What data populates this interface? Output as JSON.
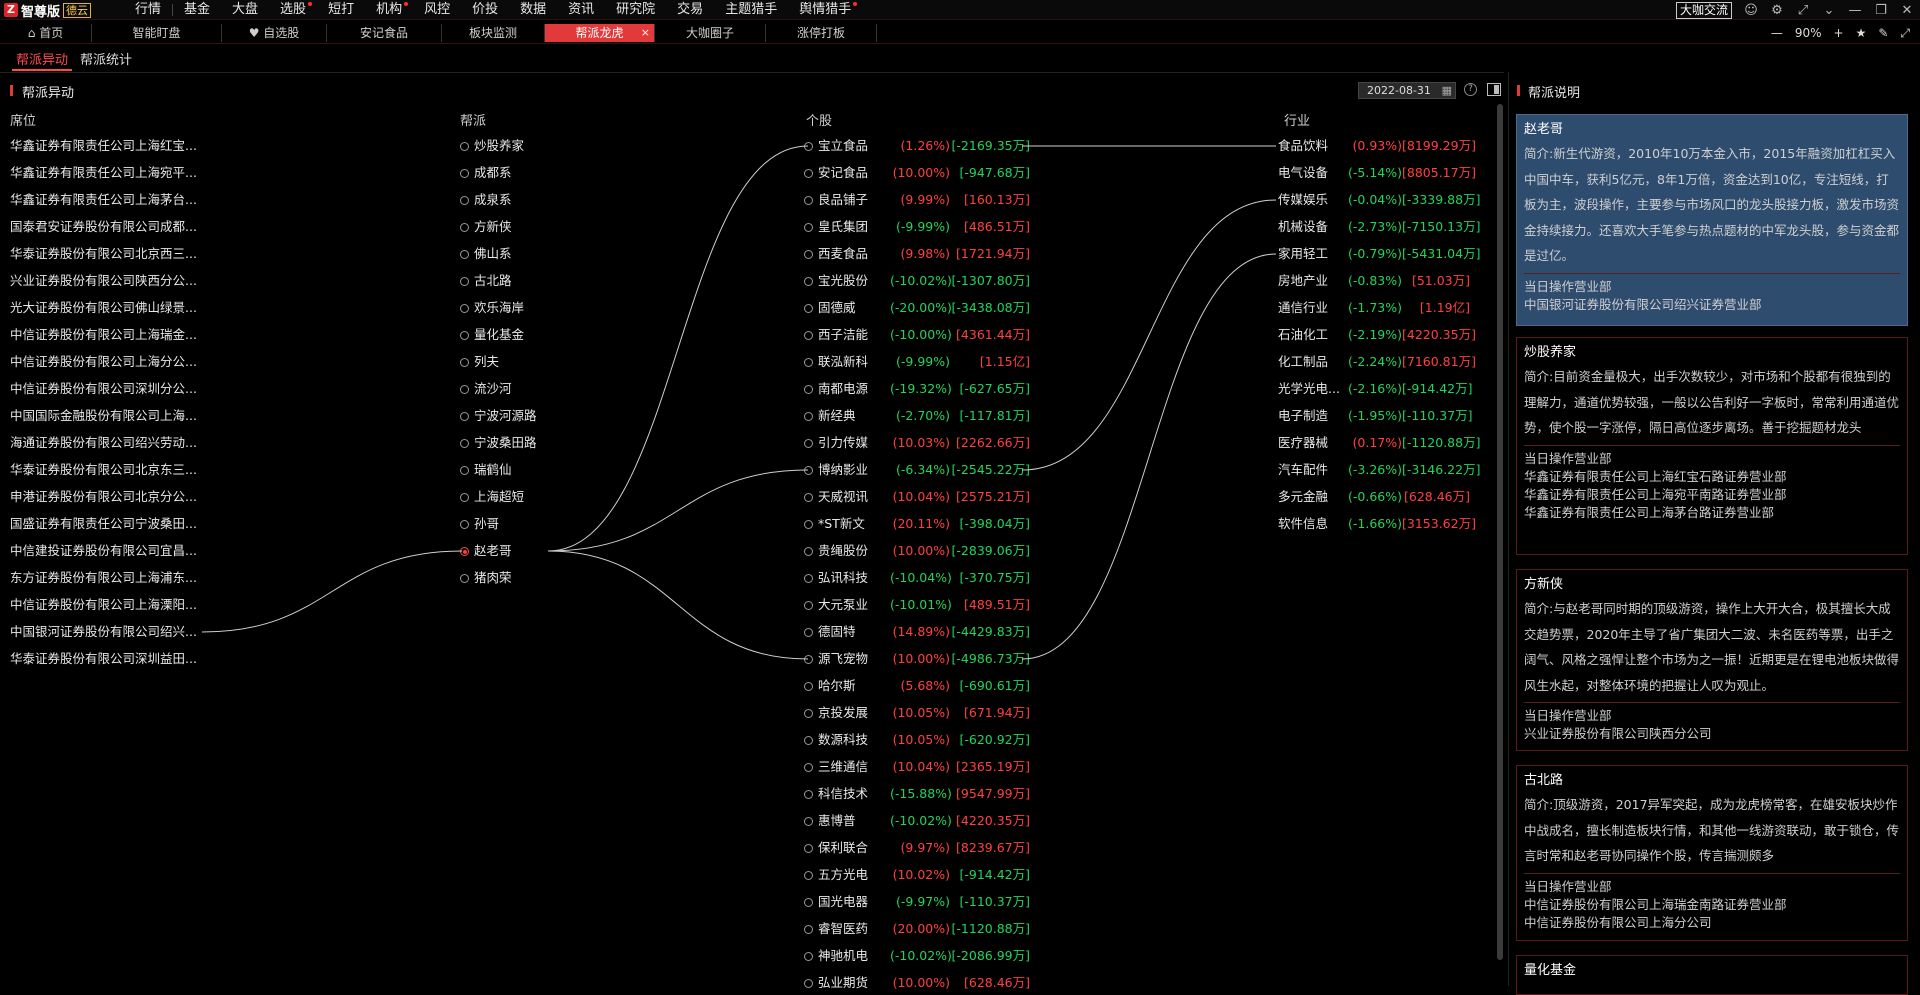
{
  "app": {
    "name": "智尊版",
    "edition": "德云",
    "menus": [
      {
        "label": "行情",
        "dot": false
      },
      {
        "label": "基金",
        "dot": false
      },
      {
        "label": "大盘",
        "dot": false
      },
      {
        "label": "选股",
        "dot": true
      },
      {
        "label": "短打",
        "dot": false
      },
      {
        "label": "机构",
        "dot": true
      },
      {
        "label": "风控",
        "dot": false
      },
      {
        "label": "价投",
        "dot": false
      },
      {
        "label": "数据",
        "dot": false
      },
      {
        "label": "资讯",
        "dot": false
      },
      {
        "label": "研究院",
        "dot": false
      },
      {
        "label": "交易",
        "dot": false
      },
      {
        "label": "主题猎手",
        "dot": false
      },
      {
        "label": "舆情猎手",
        "dot": true
      }
    ],
    "top_right_button": "大咖交流"
  },
  "tabs": [
    {
      "label": "首页",
      "icon": "home-icon"
    },
    {
      "label": "智能盯盘"
    },
    {
      "label": "自选股",
      "icon": "heart-icon"
    },
    {
      "label": "安记食品"
    },
    {
      "label": "板块监测"
    },
    {
      "label": "帮派龙虎",
      "active": true
    },
    {
      "label": "大咖圈子"
    },
    {
      "label": "涨停打板"
    }
  ],
  "zoom": {
    "value": "90%"
  },
  "subtabs": [
    {
      "label": "帮派异动",
      "active": true
    },
    {
      "label": "帮派统计"
    }
  ],
  "panel": {
    "title": "帮派异动",
    "date": "2022-08-31",
    "help": "?"
  },
  "columns": {
    "seat": "席位",
    "gang": "帮派",
    "stock": "个股",
    "industry": "行业"
  },
  "seats": [
    "华鑫证券有限责任公司上海红宝...",
    "华鑫证券有限责任公司上海宛平...",
    "华鑫证券有限责任公司上海茅台...",
    "国泰君安证券股份有限公司成都...",
    "华泰证券股份有限公司北京西三...",
    "兴业证券股份有限公司陕西分公...",
    "光大证券股份有限公司佛山绿景...",
    "中信证券股份有限公司上海瑞金...",
    "中信证券股份有限公司上海分公...",
    "中信证券股份有限公司深圳分公...",
    "中国国际金融股份有限公司上海...",
    "海通证券股份有限公司绍兴劳动...",
    "华泰证券股份有限公司北京东三...",
    "申港证券股份有限公司北京分公...",
    "国盛证券有限责任公司宁波桑田...",
    "中信建投证券股份有限公司宜昌...",
    "东方证券股份有限公司上海浦东...",
    "中信证券股份有限公司上海溧阳...",
    "中国银河证券股份有限公司绍兴...",
    "华泰证券股份有限公司深圳益田..."
  ],
  "gangs": [
    {
      "name": "炒股养家"
    },
    {
      "name": "成都系"
    },
    {
      "name": "成泉系"
    },
    {
      "name": "方新侠"
    },
    {
      "name": "佛山系"
    },
    {
      "name": "古北路"
    },
    {
      "name": "欢乐海岸"
    },
    {
      "name": "量化基金"
    },
    {
      "name": "列夫"
    },
    {
      "name": "流沙河"
    },
    {
      "name": "宁波河源路"
    },
    {
      "name": "宁波桑田路"
    },
    {
      "name": "瑞鹤仙"
    },
    {
      "name": "上海超短"
    },
    {
      "name": "孙哥"
    },
    {
      "name": "赵老哥",
      "selected": true
    },
    {
      "name": "猪肉荣"
    }
  ],
  "stocks": [
    {
      "name": "宝立食品",
      "pct": "(1.26%)",
      "amt": "[-2169.35万]",
      "pc": "up",
      "ac": "dn"
    },
    {
      "name": "安记食品",
      "pct": "(10.00%)",
      "amt": "[-947.68万]",
      "pc": "up",
      "ac": "dn"
    },
    {
      "name": "良品铺子",
      "pct": "(9.99%)",
      "amt": "[160.13万]",
      "pc": "up",
      "ac": "up"
    },
    {
      "name": "皇氏集团",
      "pct": "(-9.99%)",
      "amt": "[486.51万]",
      "pc": "dn",
      "ac": "up"
    },
    {
      "name": "西麦食品",
      "pct": "(9.98%)",
      "amt": "[1721.94万]",
      "pc": "up",
      "ac": "up"
    },
    {
      "name": "宝光股份",
      "pct": "(-10.02%)",
      "amt": "[-1307.80万]",
      "pc": "dn",
      "ac": "dn"
    },
    {
      "name": "固德威",
      "pct": "(-20.00%)",
      "amt": "[-3438.08万]",
      "pc": "dn",
      "ac": "dn"
    },
    {
      "name": "西子洁能",
      "pct": "(-10.00%)",
      "amt": "[4361.44万]",
      "pc": "dn",
      "ac": "up"
    },
    {
      "name": "联泓新科",
      "pct": "(-9.99%)",
      "amt": "[1.15亿]",
      "pc": "dn",
      "ac": "up"
    },
    {
      "name": "南都电源",
      "pct": "(-19.32%)",
      "amt": "[-627.65万]",
      "pc": "dn",
      "ac": "dn"
    },
    {
      "name": "新经典",
      "pct": "(-2.70%)",
      "amt": "[-117.81万]",
      "pc": "dn",
      "ac": "dn"
    },
    {
      "name": "引力传媒",
      "pct": "(10.03%)",
      "amt": "[2262.66万]",
      "pc": "up",
      "ac": "up"
    },
    {
      "name": "博纳影业",
      "pct": "(-6.34%)",
      "amt": "[-2545.22万]",
      "pc": "dn",
      "ac": "dn"
    },
    {
      "name": "天威视讯",
      "pct": "(10.04%)",
      "amt": "[2575.21万]",
      "pc": "up",
      "ac": "up"
    },
    {
      "name": "*ST新文",
      "pct": "(20.11%)",
      "amt": "[-398.04万]",
      "pc": "up",
      "ac": "dn"
    },
    {
      "name": "贵绳股份",
      "pct": "(10.00%)",
      "amt": "[-2839.06万]",
      "pc": "up",
      "ac": "dn"
    },
    {
      "name": "弘讯科技",
      "pct": "(-10.04%)",
      "amt": "[-370.75万]",
      "pc": "dn",
      "ac": "dn"
    },
    {
      "name": "大元泵业",
      "pct": "(-10.01%)",
      "amt": "[489.51万]",
      "pc": "dn",
      "ac": "up"
    },
    {
      "name": "德固特",
      "pct": "(14.89%)",
      "amt": "[-4429.83万]",
      "pc": "up",
      "ac": "dn"
    },
    {
      "name": "源飞宠物",
      "pct": "(10.00%)",
      "amt": "[-4986.73万]",
      "pc": "up",
      "ac": "dn"
    },
    {
      "name": "哈尔斯",
      "pct": "(5.68%)",
      "amt": "[-690.61万]",
      "pc": "up",
      "ac": "dn"
    },
    {
      "name": "京投发展",
      "pct": "(10.05%)",
      "amt": "[671.94万]",
      "pc": "up",
      "ac": "up"
    },
    {
      "name": "数源科技",
      "pct": "(10.05%)",
      "amt": "[-620.92万]",
      "pc": "up",
      "ac": "dn"
    },
    {
      "name": "三维通信",
      "pct": "(10.04%)",
      "amt": "[2365.19万]",
      "pc": "up",
      "ac": "up"
    },
    {
      "name": "科信技术",
      "pct": "(-15.88%)",
      "amt": "[9547.99万]",
      "pc": "dn",
      "ac": "up"
    },
    {
      "name": "惠博普",
      "pct": "(-10.02%)",
      "amt": "[4220.35万]",
      "pc": "dn",
      "ac": "up"
    },
    {
      "name": "保利联合",
      "pct": "(9.97%)",
      "amt": "[8239.67万]",
      "pc": "up",
      "ac": "up"
    },
    {
      "name": "五方光电",
      "pct": "(10.02%)",
      "amt": "[-914.42万]",
      "pc": "up",
      "ac": "dn"
    },
    {
      "name": "国光电器",
      "pct": "(-9.97%)",
      "amt": "[-110.37万]",
      "pc": "dn",
      "ac": "dn"
    },
    {
      "name": "睿智医药",
      "pct": "(20.00%)",
      "amt": "[-1120.88万]",
      "pc": "up",
      "ac": "dn"
    },
    {
      "name": "神驰机电",
      "pct": "(-10.02%)",
      "amt": "[-2086.99万]",
      "pc": "dn",
      "ac": "dn"
    },
    {
      "name": "弘业期货",
      "pct": "(10.00%)",
      "amt": "[628.46万]",
      "pc": "up",
      "ac": "up"
    }
  ],
  "industries": [
    {
      "name": "食品饮料",
      "pct": "(0.93%)",
      "amt": "[8199.29万]",
      "pc": "up",
      "ac": "up"
    },
    {
      "name": "电气设备",
      "pct": "(-5.14%)",
      "amt": "[8805.17万]",
      "pc": "dn",
      "ac": "up"
    },
    {
      "name": "传媒娱乐",
      "pct": "(-0.04%)",
      "amt": "[-3339.88万]",
      "pc": "dn",
      "ac": "dn"
    },
    {
      "name": "机械设备",
      "pct": "(-2.73%)",
      "amt": "[-7150.13万]",
      "pc": "dn",
      "ac": "dn"
    },
    {
      "name": "家用轻工",
      "pct": "(-0.79%)",
      "amt": "[-5431.04万]",
      "pc": "dn",
      "ac": "dn"
    },
    {
      "name": "房地产业",
      "pct": "(-0.83%)",
      "amt": "[51.03万]",
      "pc": "dn",
      "ac": "up"
    },
    {
      "name": "通信行业",
      "pct": "(-1.73%)",
      "amt": "[1.19亿]",
      "pc": "dn",
      "ac": "up"
    },
    {
      "name": "石油化工",
      "pct": "(-2.19%)",
      "amt": "[4220.35万]",
      "pc": "dn",
      "ac": "up"
    },
    {
      "name": "化工制品",
      "pct": "(-2.24%)",
      "amt": "[7160.81万]",
      "pc": "dn",
      "ac": "up"
    },
    {
      "name": "光学光电...",
      "pct": "(-2.16%)",
      "amt": "[-914.42万]",
      "pc": "dn",
      "ac": "dn"
    },
    {
      "name": "电子制造",
      "pct": "(-1.95%)",
      "amt": "[-110.37万]",
      "pc": "dn",
      "ac": "dn"
    },
    {
      "name": "医疗器械",
      "pct": "(0.17%)",
      "amt": "[-1120.88万]",
      "pc": "up",
      "ac": "dn"
    },
    {
      "name": "汽车配件",
      "pct": "(-3.26%)",
      "amt": "[-3146.22万]",
      "pc": "dn",
      "ac": "dn"
    },
    {
      "name": "多元金融",
      "pct": "(-0.66%)",
      "amt": "[628.46万]",
      "pc": "dn",
      "ac": "up"
    },
    {
      "name": "软件信息",
      "pct": "(-1.66%)",
      "amt": "[3153.62万]",
      "pc": "dn",
      "ac": "up"
    }
  ],
  "right_panel": {
    "title": "帮派说明",
    "op_label": "当日操作营业部",
    "cards": [
      {
        "name": "赵老哥",
        "desc": "简介:新生代游资，2010年10万本金入市，2015年融资加杠杠买入中国中车，获利5亿元，8年1万倍，资金达到10亿，专注短线，打板为主，波段操作，主要参与市场风口的龙头股接力板，激发市场资金持续接力。还喜欢大手笔参与热点题材的中军龙头股，参与资金都是过亿。",
        "branches": [
          "中国银河证券股份有限公司绍兴证券营业部"
        ]
      },
      {
        "name": "炒股养家",
        "desc": "简介:目前资金量极大，出手次数较少，对市场和个股都有很独到的理解力，通道优势较强，一般以公告利好一字板时，常常利用通道优势，使个股一字涨停，隔日高位逐步离场。善于挖掘题材龙头",
        "branches": [
          "华鑫证券有限责任公司上海红宝石路证券营业部",
          "华鑫证券有限责任公司上海宛平南路证券营业部",
          "华鑫证券有限责任公司上海茅台路证券营业部"
        ]
      },
      {
        "name": "方新侠",
        "desc": "简介:与赵老哥同时期的顶级游资，操作上大开大合，极其擅长大成交趋势票，2020年主导了省广集团大二波、未名医药等票，出手之阔气、风格之强悍让整个市场为之一振！近期更是在锂电池板块做得风生水起，对整体环境的把握让人叹为观止。",
        "branches": [
          "兴业证券股份有限公司陕西分公司"
        ]
      },
      {
        "name": "古北路",
        "desc": "简介:顶级游资，2017异军突起，成为龙虎榜常客，在雄安板块炒作中战成名，擅长制造板块行情，和其他一线游资联动，敢于锁仓，传言时常和赵老哥协同操作个股，传言揣测颇多",
        "branches": [
          "中信证券股份有限公司上海瑞金南路证券营业部",
          "中信证券股份有限公司上海分公司"
        ]
      },
      {
        "name": "量化基金",
        "desc": "",
        "branches": []
      }
    ]
  },
  "colors": {
    "up": "#ff4040",
    "down": "#22d45a",
    "accent": "#e23a3a",
    "selected_card": "#2e4c6e"
  }
}
